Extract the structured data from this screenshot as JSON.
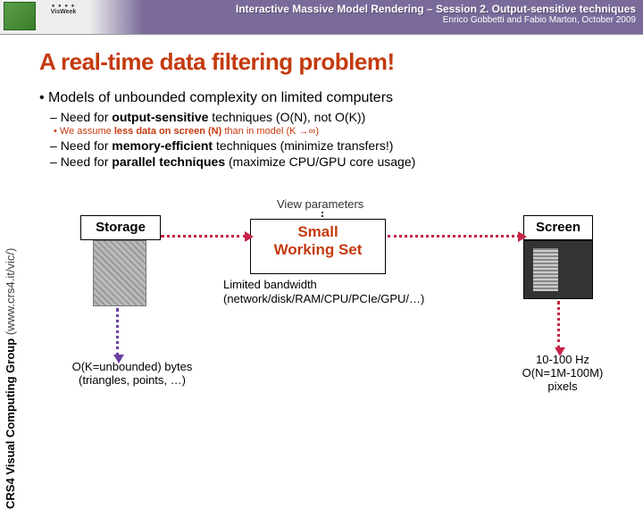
{
  "header": {
    "title": "Interactive Massive Model Rendering – Session 2. Output-sensitive techniques",
    "subtitle": "Enrico Gobbetti and Fabio Marton, October 2009"
  },
  "sidebar": {
    "bold": "CRS4 Visual Computing Group",
    "light": " (www.crs4.it/vic/)"
  },
  "slide": {
    "title": "A real-time data filtering problem!",
    "bullets": {
      "l1": "Models of unbounded complexity on limited computers",
      "s1": "Need for output-sensitive techniques (O(N), not O(K))",
      "s1a": "We assume less data on screen (N) than in model (K →∞)",
      "s2": "Need for memory-efficient techniques (minimize transfers!)",
      "s3": "Need for parallel techniques (maximize CPU/GPU core usage)"
    }
  },
  "diagram": {
    "view_params": "View parameters",
    "storage": "Storage",
    "working_set_l1": "Small",
    "working_set_l2": "Working Set",
    "screen": "Screen",
    "bandwidth_l1": "Limited bandwidth",
    "bandwidth_l2": "(network/disk/RAM/CPU/PCIe/GPU/…)",
    "bottom_left_l1": "O(K=unbounded) bytes",
    "bottom_left_l2": "(triangles, points, …)",
    "bottom_right_l1": "10-100 Hz",
    "bottom_right_l2": "O(N=1M-100M)",
    "bottom_right_l3": "pixels"
  }
}
